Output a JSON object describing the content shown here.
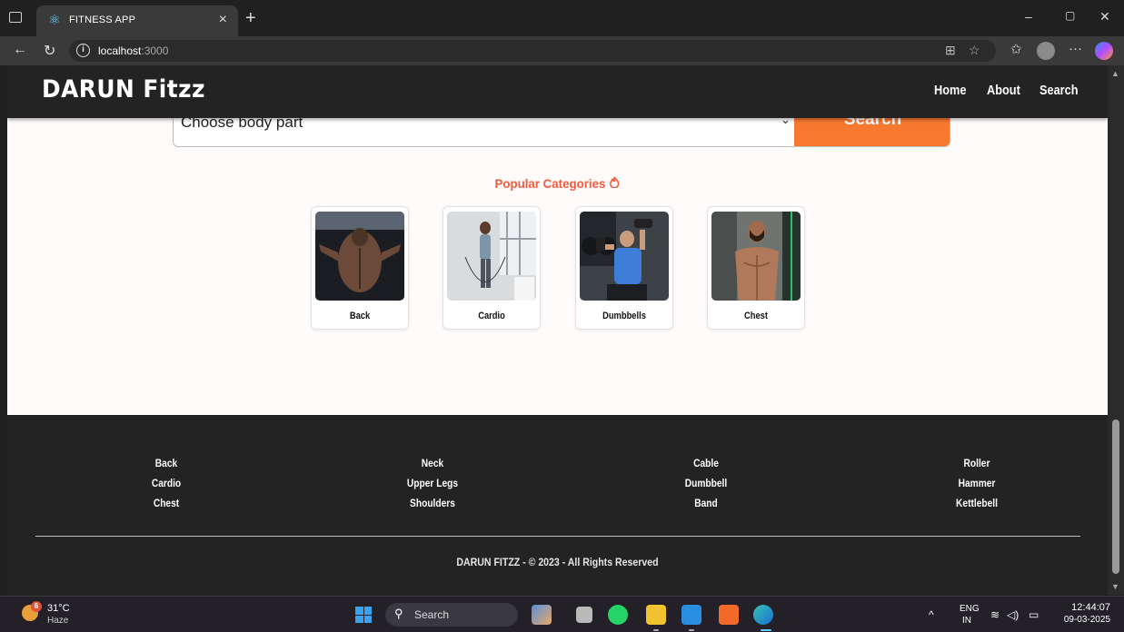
{
  "browser": {
    "tab_title": "FITNESS APP",
    "tab_close": "×",
    "new_tab": "+",
    "url_host": "localhost",
    "url_port": ":3000",
    "win_min": "–",
    "win_restore": "▢",
    "win_close": "✕"
  },
  "site": {
    "logo": "DARUN Fitzz",
    "nav": [
      "Home",
      "About",
      "Search"
    ]
  },
  "search": {
    "select_value": "Choose body part",
    "button_label": "Search"
  },
  "categories": {
    "title": "Popular Categories",
    "items": [
      {
        "label": "Back"
      },
      {
        "label": "Cardio"
      },
      {
        "label": "Dumbbells"
      },
      {
        "label": "Chest"
      }
    ]
  },
  "footer": {
    "columns": [
      [
        "Back",
        "Cardio",
        "Chest"
      ],
      [
        "Neck",
        "Upper Legs",
        "Shoulders"
      ],
      [
        "Cable",
        "Dumbbell",
        "Band"
      ],
      [
        "Roller",
        "Hammer",
        "Kettlebell"
      ]
    ],
    "copyright": "DARUN FITZZ - © 2023 - All Rights Reserved"
  },
  "taskbar": {
    "weather_badge": "6",
    "temperature": "31°C",
    "condition": "Haze",
    "search_placeholder": "Search",
    "lang_line1": "ENG",
    "lang_line2": "IN",
    "time": "12:44:07",
    "date": "09-03-2025"
  },
  "colors": {
    "accent": "#f9782f",
    "title_red": "#f25a3c",
    "header_bg": "#232323",
    "page_bg": "#fffbfb"
  }
}
